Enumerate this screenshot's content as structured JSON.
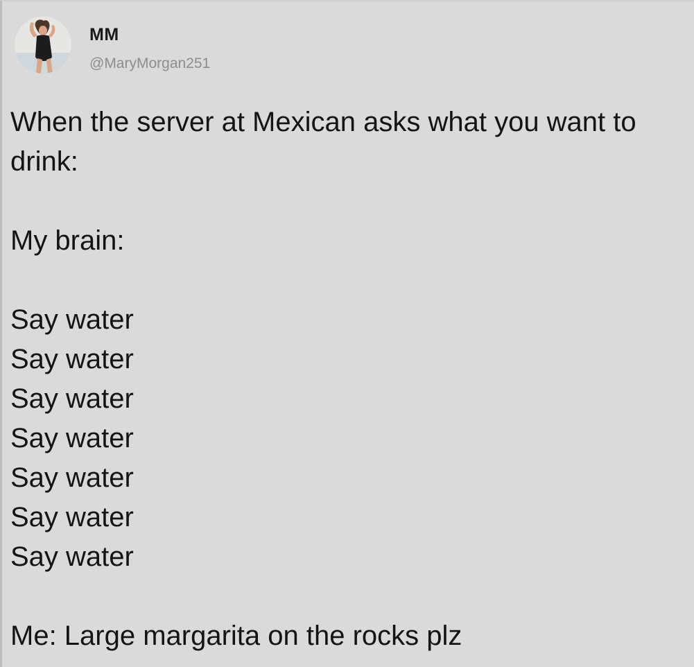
{
  "tweet": {
    "author": {
      "display_name": "MM",
      "handle": "@MaryMorgan251",
      "avatar": "profile-photo"
    },
    "text": {
      "intro_line_1": "When the server at Mexican asks what you want to",
      "intro_line_2": "drink:",
      "brain_label": "My brain:",
      "repeated_lines": [
        "Say water",
        "Say water",
        "Say water",
        "Say water",
        "Say water",
        "Say water",
        "Say water"
      ],
      "punchline": "Me: Large margarita on the rocks plz"
    }
  }
}
